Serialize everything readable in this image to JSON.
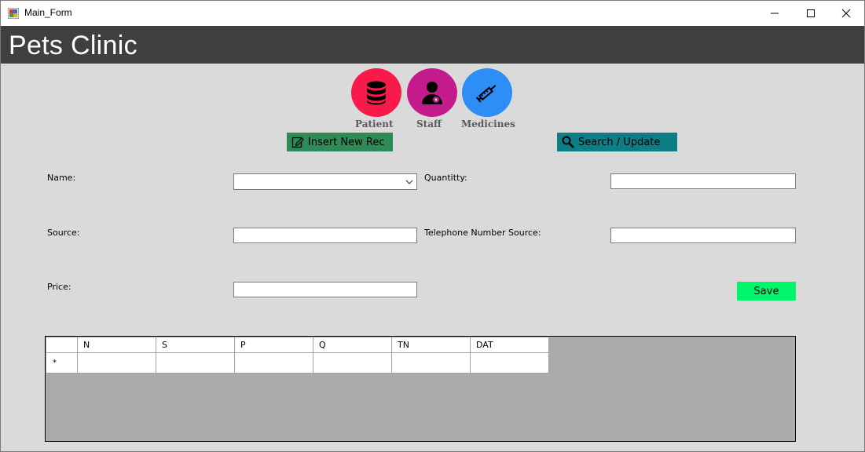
{
  "window": {
    "title": "Main_Form",
    "controls": {
      "minimize": "minimize",
      "maximize": "maximize",
      "close": "close"
    }
  },
  "header": {
    "app_title": "Pets Clinic"
  },
  "nav": [
    {
      "label": "Patient",
      "icon": "database-icon",
      "color": "#f81b4a"
    },
    {
      "label": "Staff",
      "icon": "doctor-icon",
      "color": "#c41b8c"
    },
    {
      "label": "Medicines",
      "icon": "syringe-icon",
      "color": "#2d8ff5"
    }
  ],
  "actions": {
    "insert_label": "Insert New Rec",
    "insert_color": "#2e8b57",
    "search_label": "Search / Update",
    "search_color": "#0d7d86"
  },
  "form": {
    "name_label": "Name:",
    "name_value": "",
    "source_label": "Source:",
    "source_value": "",
    "price_label": "Price:",
    "price_value": "",
    "quantity_label": "Quantitty:",
    "quantity_value": "",
    "telephone_label": "Telephone Number Source:",
    "telephone_value": "",
    "save_label": "Save",
    "save_color": "#00f46c"
  },
  "grid": {
    "columns": [
      "N",
      "S",
      "P",
      "Q",
      "TN",
      "DAT"
    ],
    "new_row_marker": "*"
  }
}
